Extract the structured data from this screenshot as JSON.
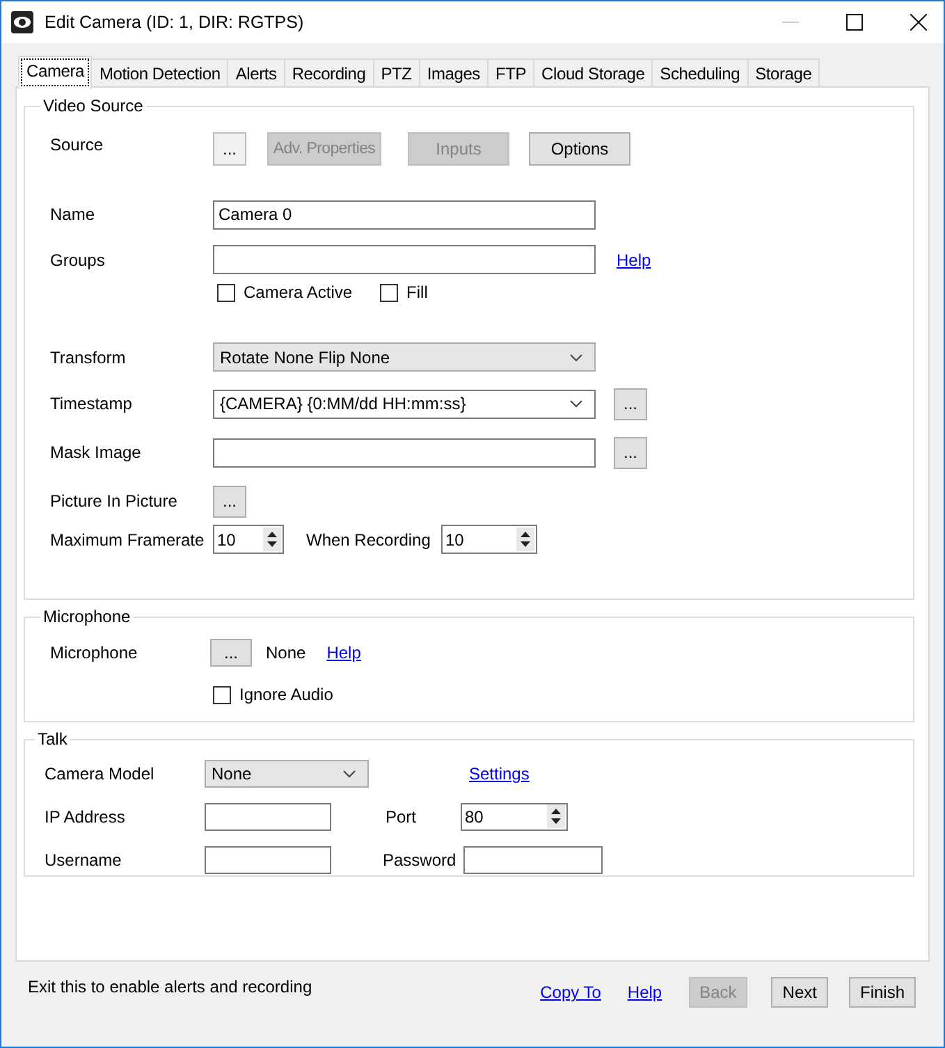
{
  "window": {
    "title": "Edit Camera (ID: 1, DIR: RGTPS)"
  },
  "tabs": [
    {
      "label": "Camera",
      "selected": true
    },
    {
      "label": "Motion Detection",
      "selected": false
    },
    {
      "label": "Alerts",
      "selected": false
    },
    {
      "label": "Recording",
      "selected": false
    },
    {
      "label": "PTZ",
      "selected": false
    },
    {
      "label": "Images",
      "selected": false
    },
    {
      "label": "FTP",
      "selected": false
    },
    {
      "label": "Cloud Storage",
      "selected": false
    },
    {
      "label": "Scheduling",
      "selected": false
    },
    {
      "label": "Storage",
      "selected": false
    }
  ],
  "video_source": {
    "title": "Video Source",
    "source": {
      "label": "Source",
      "buttons": [
        {
          "label": "...",
          "disabled": false
        },
        {
          "label": "Adv. Properties",
          "disabled": true
        },
        {
          "label": "Inputs",
          "disabled": true
        },
        {
          "label": "Options",
          "disabled": false
        }
      ]
    },
    "name": {
      "label": "Name",
      "value": "Camera 0"
    },
    "groups": {
      "label": "Groups",
      "help": "Help"
    },
    "checkboxes": [
      {
        "label": "Camera Active",
        "checked": false
      },
      {
        "label": "Fill",
        "checked": false
      }
    ],
    "transform": {
      "label": "Transform",
      "value": "Rotate None Flip None"
    },
    "timestamp": {
      "label": "Timestamp",
      "value": "{CAMERA} {0:MM/dd HH:mm:ss}",
      "button": "..."
    },
    "mask_image": {
      "label": "Mask Image",
      "button": "..."
    },
    "picture_in_picture": {
      "label": "Picture In Picture",
      "button": "..."
    },
    "max_framerate": {
      "label": "Maximum Framerate",
      "value": "10"
    },
    "when_recording": {
      "label": "When Recording",
      "value": "10"
    }
  },
  "microphone": {
    "title": "Microphone",
    "label": "Microphone",
    "button": "...",
    "device": "None",
    "help": "Help",
    "ignore_audio": {
      "label": "Ignore Audio",
      "checked": false
    }
  },
  "talk": {
    "title": "Talk",
    "camera_model": {
      "label": "Camera Model",
      "value": "None"
    },
    "settings": "Settings",
    "ip_address": {
      "label": "IP Address"
    },
    "port": {
      "label": "Port",
      "value": "80"
    },
    "username": {
      "label": "Username"
    },
    "password": {
      "label": "Password"
    }
  },
  "footer": {
    "status": "Exit this to enable alerts and recording",
    "links": [
      "Copy To",
      "Help"
    ],
    "buttons": [
      {
        "label": "Back",
        "disabled": true
      },
      {
        "label": "Next",
        "disabled": false
      },
      {
        "label": "Finish",
        "disabled": false
      }
    ]
  }
}
